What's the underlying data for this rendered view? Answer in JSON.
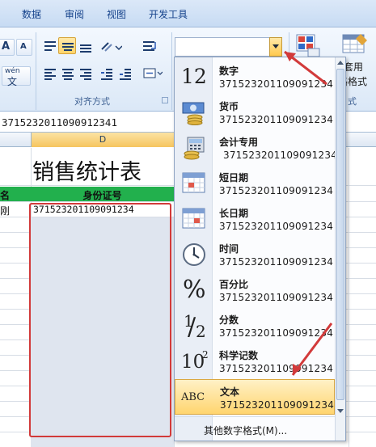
{
  "ribbon": {
    "tabs": [
      "数据",
      "审阅",
      "视图",
      "开发工具"
    ],
    "alignment_group_label": "对齐方式",
    "number_group_label_fragment": "式",
    "style_button_fragments": [
      "套用",
      "格格式"
    ],
    "font_buttons": [
      "A",
      "A",
      "wén"
    ]
  },
  "formula_bar": {
    "value": "3715232011090912341"
  },
  "sheet": {
    "column_header": "D",
    "title": "销售统计表",
    "header_left_fragment": "名",
    "header_id": "身份证号",
    "first_row_left_fragment": "刚",
    "first_row_id": "371523201109091234"
  },
  "number_format_dropdown": {
    "items": [
      {
        "name": "数字",
        "sample": "371523201109091234",
        "icon": "number-12-icon"
      },
      {
        "name": "货币",
        "sample": "371523201109091234",
        "icon": "currency-coins-icon"
      },
      {
        "name": "会计专用",
        "sample": "371523201109091234",
        "icon": "accounting-calculator-icon"
      },
      {
        "name": "短日期",
        "sample": "371523201109091234",
        "icon": "calendar-short-icon"
      },
      {
        "name": "长日期",
        "sample": "371523201109091234",
        "icon": "calendar-long-icon"
      },
      {
        "name": "时间",
        "sample": "371523201109091234",
        "icon": "clock-icon"
      },
      {
        "name": "百分比",
        "sample": "371523201109091234",
        "icon": "percent-icon"
      },
      {
        "name": "分数",
        "sample": "371523201109091234",
        "icon": "fraction-half-icon"
      },
      {
        "name": "科学记数",
        "sample": "371523201109091234",
        "icon": "scientific-10-squared-icon"
      },
      {
        "name": "文本",
        "sample": "371523201109091234",
        "icon": "text-abc-icon"
      }
    ],
    "selected_item": "文本",
    "more_formats_label": "其他数字格式(M)..."
  },
  "icon_text": {
    "number": "12",
    "percent": "%",
    "fraction_num": "1",
    "fraction_den": "2",
    "sci_base": "10",
    "sci_exp": "2",
    "text_abc": "ABC"
  },
  "colors": {
    "annotation_red": "#d23a3a",
    "header_green": "#22b04d",
    "selected_highlight": "#ffd56f"
  }
}
